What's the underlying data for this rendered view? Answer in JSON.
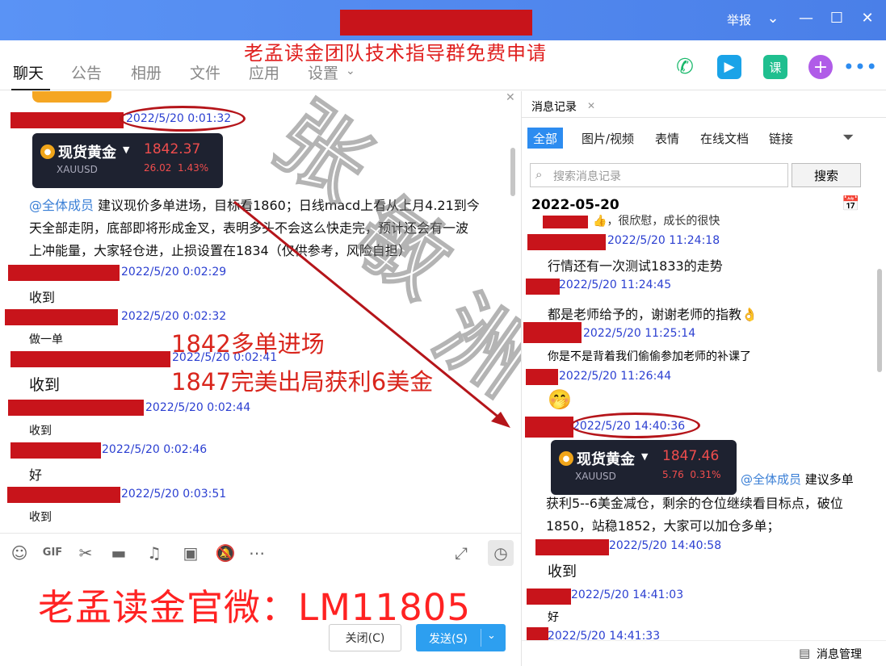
{
  "window": {
    "report_label": "举报",
    "controls": [
      "chevron-down-icon",
      "minimize-icon",
      "maximize-icon",
      "close-icon"
    ]
  },
  "banner_text": "老孟读金团队技术指导群免费申请",
  "tabs": [
    "聊天",
    "公告",
    "相册",
    "文件",
    "应用",
    "设置"
  ],
  "chat": {
    "messages": {
      "m1": {
        "time": "2022/5/20 0:01:32"
      },
      "card1": {
        "name": "现货黄金",
        "symbol": "XAUUSD",
        "price": "1842.37",
        "change": "26.02",
        "pct": "1.43%"
      },
      "text1": {
        "mention": "@全体成员",
        "line1": " 建议现价多单进场，目标看1860；日线macd上看从上月4.21到今",
        "line2": "天全部走阴，底部即将形成金叉，表明多头不会这么快走完，预计还会有一波",
        "line3": "上冲能量，大家轻仓进，止损设置在1834（仅供参考，风险自担）"
      },
      "m2": {
        "time": "2022/5/20 0:02:29",
        "text": "收到"
      },
      "m3": {
        "time": "2022/5/20 0:02:32",
        "text": "做一单"
      },
      "m4": {
        "time": "2022/5/20 0:02:41",
        "text": "收到"
      },
      "m5": {
        "time": "2022/5/20 0:02:44",
        "text": "收到"
      },
      "m6": {
        "time": "2022/5/20 0:02:46",
        "text": "好"
      },
      "m7": {
        "time": "2022/5/20 0:03:51",
        "text": "收到"
      }
    },
    "overlay_line1": "1842多单进场",
    "overlay_line2": "1847完美出局获利6美金"
  },
  "toolbar_icons": [
    "emoji-icon",
    "gif-icon",
    "scissors-icon",
    "folder-icon",
    "music-icon",
    "image-icon",
    "bell-off-icon",
    "more-icon"
  ],
  "wechat_text": "老孟读金官微：LM11805",
  "buttons": {
    "close": "关闭(C)",
    "send": "发送(S)"
  },
  "side": {
    "panel_title": "消息记录",
    "filters": [
      "全部",
      "图片/视频",
      "表情",
      "在线文档",
      "链接"
    ],
    "search_placeholder": "搜索消息记录",
    "search_button": "搜索",
    "date": "2022-05-20",
    "partial_text": "，很欣慰，成长的很快",
    "entries": {
      "e1": {
        "time": "2022/5/20 11:24:18",
        "text": "行情还有一次测试1833的走势"
      },
      "e2": {
        "time": "2022/5/20 11:24:45",
        "text": "都是老师给予的，谢谢老师的指教"
      },
      "e3": {
        "time": "2022/5/20 11:25:14",
        "text": "你是不是背着我们偷偷参加老师的补课了"
      },
      "e4": {
        "time": "2022/5/20 11:26:44"
      },
      "e5": {
        "time": "2022/5/20 14:40:36"
      },
      "card2": {
        "name": "现货黄金",
        "symbol": "XAUUSD",
        "price": "1847.46",
        "change": "5.76",
        "pct": "0.31%"
      },
      "e5text": {
        "mention": "@全体成员",
        "line1": " 建议多单",
        "line2": "获利5--6美金减仓，剩余的仓位继续看目标点，破位",
        "line3": "1850，站稳1852，大家可以加仓多单；"
      },
      "e6": {
        "time": "2022/5/20 14:40:58",
        "text": "收到"
      },
      "e7": {
        "time": "2022/5/20 14:41:03",
        "text": "好"
      },
      "e8": {
        "time": "2022/5/20 14:41:33"
      }
    },
    "manage_label": "消息管理"
  }
}
